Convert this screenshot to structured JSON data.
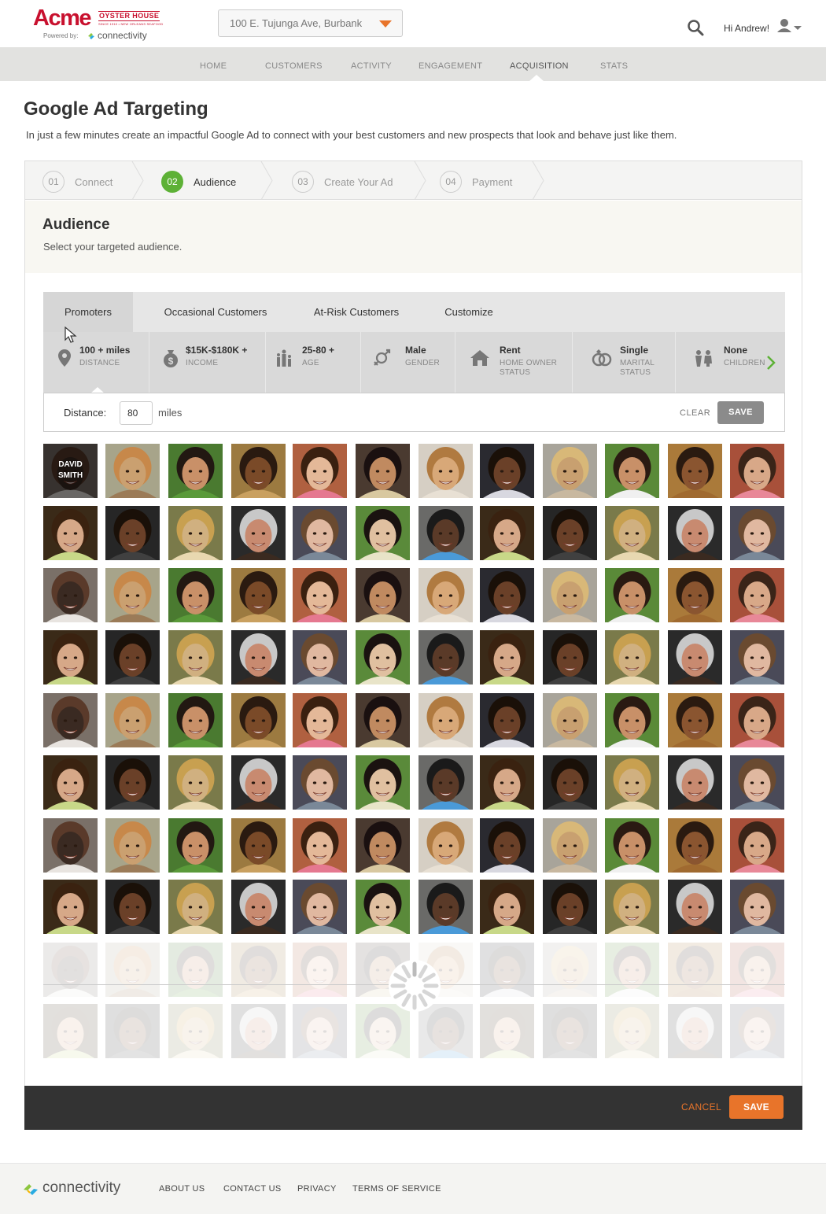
{
  "brand": {
    "name": "Acme",
    "tagline": "OYSTER HOUSE",
    "since": "SINCE 1910 • NEW ORLEANS SEAFOOD",
    "powered_by": "Powered by:",
    "platform": "connectivity",
    "color": "#c8102e"
  },
  "header": {
    "location": "100 E. Tujunga Ave, Burbank",
    "greeting": "Hi Andrew!"
  },
  "nav": {
    "items": [
      "HOME",
      "CUSTOMERS",
      "ACTIVITY",
      "ENGAGEMENT",
      "ACQUISITION",
      "STATS"
    ],
    "active": "ACQUISITION"
  },
  "page": {
    "title": "Google Ad Targeting",
    "subtitle": "In just a few minutes create an impactful Google Ad to connect with your best customers and new prospects that look and behave just like them."
  },
  "steps": [
    {
      "num": "01",
      "label": "Connect",
      "active": false
    },
    {
      "num": "02",
      "label": "Audience",
      "active": true
    },
    {
      "num": "03",
      "label": "Create Your Ad",
      "active": false
    },
    {
      "num": "04",
      "label": "Payment",
      "active": false
    }
  ],
  "audience": {
    "title": "Audience",
    "subtitle": "Select your targeted audience."
  },
  "tabs": {
    "items": [
      "Promoters",
      "Occasional Customers",
      "At-Risk Customers",
      "Customize"
    ],
    "active": "Promoters"
  },
  "filters": [
    {
      "value": "100 + miles",
      "label": "DISTANCE",
      "icon": "map-pin-icon"
    },
    {
      "value": "$15K-$180K +",
      "label": "INCOME",
      "icon": "money-bag-icon"
    },
    {
      "value": "25-80 +",
      "label": "AGE",
      "icon": "age-people-icon"
    },
    {
      "value": "Male",
      "label": "GENDER",
      "icon": "gender-icon"
    },
    {
      "value": "Rent",
      "label": "HOME OWNER STATUS",
      "icon": "house-icon"
    },
    {
      "value": "Single",
      "label": "MARITAL STATUS",
      "icon": "rings-icon"
    },
    {
      "value": "None",
      "label": "CHILDREN",
      "icon": "children-icon"
    }
  ],
  "distance": {
    "label": "Distance:",
    "value": "80",
    "unit": "miles",
    "clear_label": "CLEAR",
    "save_label": "SAVE"
  },
  "grid": {
    "hover_name_first": "DAVID",
    "hover_name_last": "SMITH"
  },
  "actions": {
    "cancel_label": "CANCEL",
    "save_label": "SAVE",
    "accent": "#e8742a"
  },
  "footer": {
    "brand": "connectivity",
    "links": [
      "ABOUT US",
      "CONTACT US",
      "PRIVACY",
      "TERMS OF SERVICE"
    ]
  }
}
